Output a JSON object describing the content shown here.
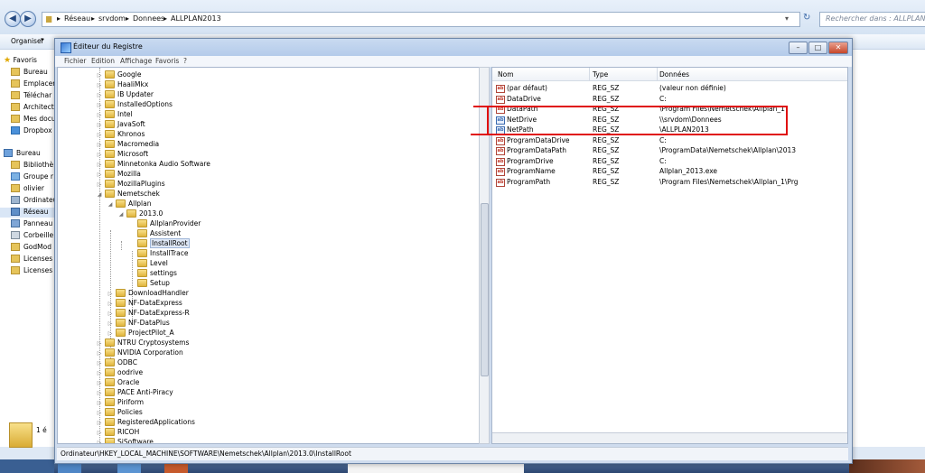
{
  "explorer": {
    "breadcrumbs": [
      "Réseau",
      "srvdom",
      "Donnees",
      "ALLPLAN2013"
    ],
    "search_placeholder": "Rechercher dans : ALLPLAN2013",
    "organize_label": "Organiser",
    "favorites_label": "Favoris",
    "nav_items": [
      "Bureau",
      "Emplacem",
      "Téléchar",
      "Architect",
      "Mes docu",
      "Dropbox"
    ],
    "desktop_label": "Bureau",
    "desktop_items": [
      "Bibliothè",
      "Groupe r",
      "olivier",
      "Ordinateu",
      "Réseau",
      "Panneau",
      "Corbeille",
      "GodMod",
      "Licenses",
      "Licenses"
    ],
    "status_count": "1 é"
  },
  "regedit": {
    "title": "Éditeur du Registre",
    "menu": [
      "Fichier",
      "Edition",
      "Affichage",
      "Favoris",
      "?"
    ],
    "tree": [
      {
        "label": "Google",
        "level": 0
      },
      {
        "label": "HaaliMkx",
        "level": 0
      },
      {
        "label": "IB Updater",
        "level": 0
      },
      {
        "label": "InstalledOptions",
        "level": 0
      },
      {
        "label": "Intel",
        "level": 0
      },
      {
        "label": "JavaSoft",
        "level": 0
      },
      {
        "label": "Khronos",
        "level": 0
      },
      {
        "label": "Macromedia",
        "level": 0
      },
      {
        "label": "Microsoft",
        "level": 0
      },
      {
        "label": "Minnetonka Audio Software",
        "level": 0
      },
      {
        "label": "Mozilla",
        "level": 0
      },
      {
        "label": "MozillaPlugins",
        "level": 0
      },
      {
        "label": "Nemetschek",
        "level": 0,
        "expanded": true
      },
      {
        "label": "Allplan",
        "level": 1,
        "expanded": true
      },
      {
        "label": "2013.0",
        "level": 2,
        "expanded": true
      },
      {
        "label": "AllplanProvider",
        "level": 3
      },
      {
        "label": "Assistent",
        "level": 3
      },
      {
        "label": "InstallRoot",
        "level": 3,
        "selected": true
      },
      {
        "label": "InstallTrace",
        "level": 3
      },
      {
        "label": "Level",
        "level": 3
      },
      {
        "label": "settings",
        "level": 3
      },
      {
        "label": "Setup",
        "level": 3
      },
      {
        "label": "DownloadHandler",
        "level": 1
      },
      {
        "label": "NF-DataExpress",
        "level": 1
      },
      {
        "label": "NF-DataExpress-R",
        "level": 1
      },
      {
        "label": "NF-DataPlus",
        "level": 1
      },
      {
        "label": "ProjectPilot_A",
        "level": 1
      },
      {
        "label": "NTRU Cryptosystems",
        "level": 0
      },
      {
        "label": "NVIDIA Corporation",
        "level": 0
      },
      {
        "label": "ODBC",
        "level": 0
      },
      {
        "label": "oodrive",
        "level": 0
      },
      {
        "label": "Oracle",
        "level": 0
      },
      {
        "label": "PACE Anti-Piracy",
        "level": 0
      },
      {
        "label": "Piriform",
        "level": 0
      },
      {
        "label": "Policies",
        "level": 0
      },
      {
        "label": "RegisteredApplications",
        "level": 0
      },
      {
        "label": "RICOH",
        "level": 0
      },
      {
        "label": "SiSoftware",
        "level": 0
      }
    ],
    "columns": [
      "Nom",
      "Type",
      "Données"
    ],
    "values": [
      {
        "name": "(par défaut)",
        "type": "REG_SZ",
        "data": "(valeur non définie)"
      },
      {
        "name": "DataDrive",
        "type": "REG_SZ",
        "data": "C:"
      },
      {
        "name": "DataPath",
        "type": "REG_SZ",
        "data": "\\Program Files\\Nemetschek\\Allplan_1"
      },
      {
        "name": "NetDrive",
        "type": "REG_SZ",
        "data": "\\\\srvdom\\Donnees"
      },
      {
        "name": "NetPath",
        "type": "REG_SZ",
        "data": "\\ALLPLAN2013"
      },
      {
        "name": "ProgramDataDrive",
        "type": "REG_SZ",
        "data": "C:"
      },
      {
        "name": "ProgramDataPath",
        "type": "REG_SZ",
        "data": "\\ProgramData\\Nemetschek\\Allplan\\2013"
      },
      {
        "name": "ProgramDrive",
        "type": "REG_SZ",
        "data": "C:"
      },
      {
        "name": "ProgramName",
        "type": "REG_SZ",
        "data": "Allplan_2013.exe"
      },
      {
        "name": "ProgramPath",
        "type": "REG_SZ",
        "data": "\\Program Files\\Nemetschek\\Allplan_1\\Prg"
      }
    ],
    "status_path": "Ordinateur\\HKEY_LOCAL_MACHINE\\SOFTWARE\\Nemetschek\\Allplan\\2013.0\\InstallRoot"
  },
  "colors": {
    "highlight": "#e01010",
    "accent": "#3c7bd6"
  }
}
